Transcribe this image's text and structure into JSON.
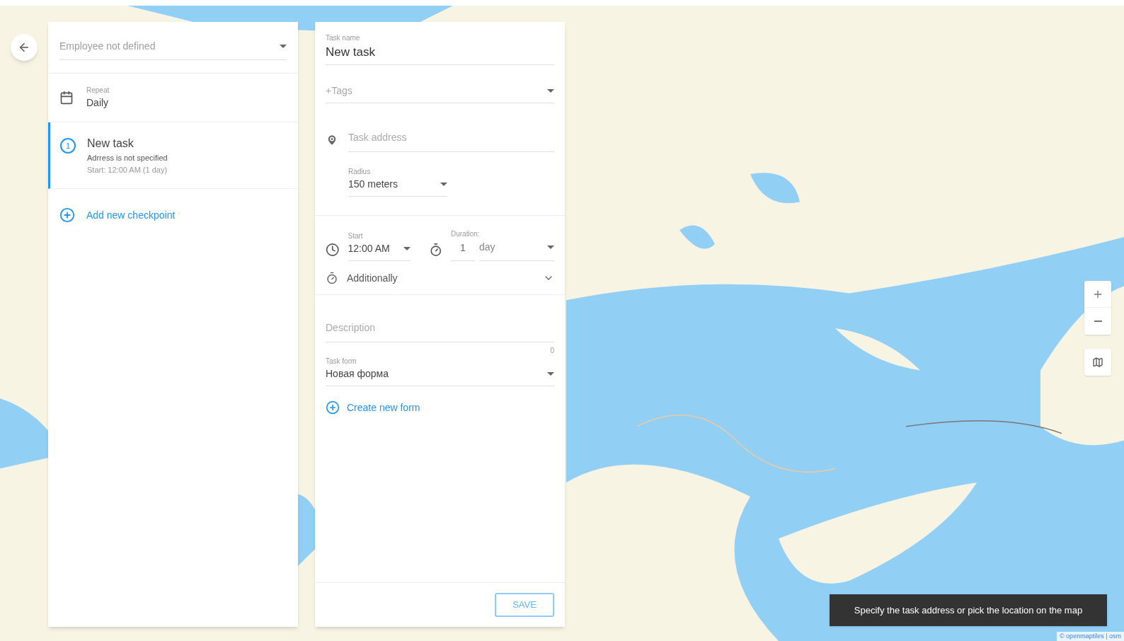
{
  "employee_select": {
    "placeholder": "Employee not defined"
  },
  "repeat": {
    "label": "Repeat",
    "value": "Daily"
  },
  "checkpoints": [
    {
      "number": "1",
      "title": "New task",
      "address": "Adrress is not specified",
      "start": "Start: 12:00 AM (1 day)",
      "selected": true
    }
  ],
  "add_checkpoint": "Add new checkpoint",
  "task": {
    "name_label": "Task name",
    "name_value": "New task",
    "tags_placeholder": "+Tags",
    "address_placeholder": "Task address",
    "radius_label": "Radius",
    "radius_value": "150 meters",
    "start_label": "Start",
    "start_value": "12:00 AM",
    "duration_label": "Duration:",
    "duration_value": "1",
    "duration_unit": "day",
    "additionally": {
      "label": "Additionally",
      "expanded": false
    },
    "description_placeholder": "Description",
    "description_counter": "0",
    "form_label": "Task form",
    "form_value": "Новая форма",
    "create_form": "Create new form",
    "save": "SAVE"
  },
  "map": {
    "toast": "Specify the task address or pick the location on the map",
    "attribution": "© openmaptiles | osm"
  }
}
